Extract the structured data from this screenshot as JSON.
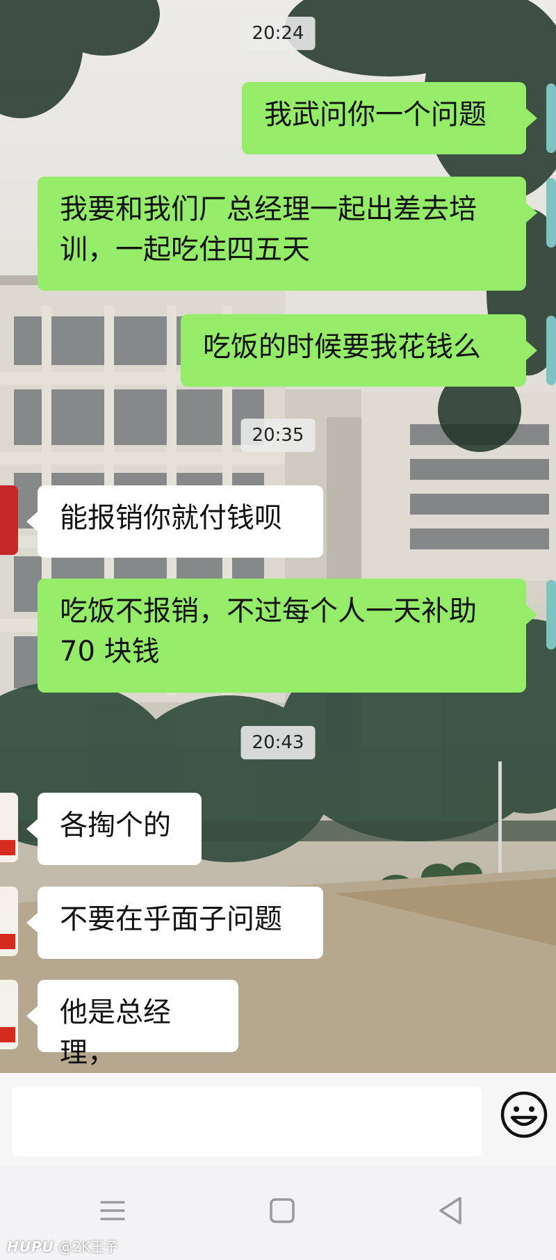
{
  "timestamps": [
    "20:24",
    "20:35",
    "20:43"
  ],
  "messages": [
    {
      "from": "me",
      "text": "我武问你一个问题"
    },
    {
      "from": "me",
      "text": "我要和我们厂总经理一起出差去培训，一起吃住四五天"
    },
    {
      "from": "me",
      "text": "吃饭的时候要我花钱么"
    },
    {
      "from": "them",
      "text": "能报销你就付钱呗"
    },
    {
      "from": "me",
      "text": "吃饭不报销，不过每个人一天补助70 块钱"
    },
    {
      "from": "them",
      "text": "各掏个的"
    },
    {
      "from": "them",
      "text": "不要在乎面子问题"
    },
    {
      "from": "them",
      "text": "他是总经理，"
    }
  ],
  "input": {
    "value": "",
    "placeholder": ""
  },
  "icons": {
    "emoji": "emoji-smiley-icon",
    "menu": "menu-icon",
    "home": "home-icon",
    "back": "back-icon"
  },
  "watermark": {
    "brand": "HUPU",
    "user": "@2K王子"
  },
  "colors": {
    "outgoing_bubble": "#95ec69",
    "incoming_bubble": "#ffffff",
    "input_bar": "#f6f6f6"
  }
}
